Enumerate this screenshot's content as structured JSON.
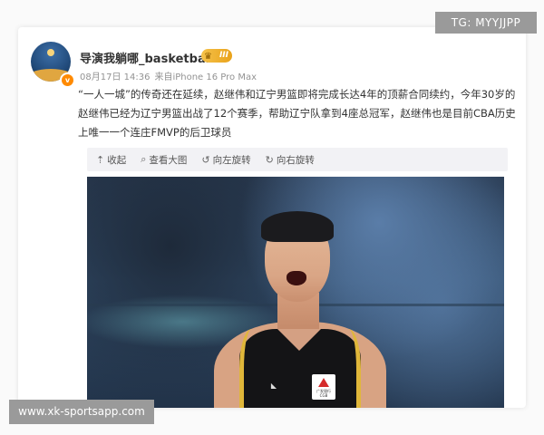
{
  "watermark": {
    "top_right": "TG: MYYJJPP",
    "bottom_left": "www.xk-sportsapp.com"
  },
  "post": {
    "username": "导演我躺哪_basketball",
    "vip_level": "III",
    "date": "08月17日 14:36",
    "source_prefix": "来自",
    "device": "iPhone 16 Pro Max",
    "text": "“一人一城”的传奇还在延续，赵继伟和辽宁男篮即将完成长达4年的顶薪合同续约，今年30岁的赵继伟已经为辽宁男篮出战了12个赛季，帮助辽宁队拿到4座总冠军，赵继伟也是目前CBA历史上唯一一个连庄FMVP的后卫球员"
  },
  "toolbar": {
    "collapse_label": "收起",
    "view_large_label": "查看大图",
    "rotate_left_label": "向左旋转",
    "rotate_right_label": "向右旋转"
  },
  "photo": {
    "jersey_sponsor_line1": "广发银行",
    "jersey_sponsor_line2": "CGB"
  },
  "colors": {
    "watermark_bg": "#9a9a9a",
    "vip_gold": "#f5c24a",
    "verified_orange": "#ff8a00",
    "jersey_gold": "#e0b73a"
  }
}
